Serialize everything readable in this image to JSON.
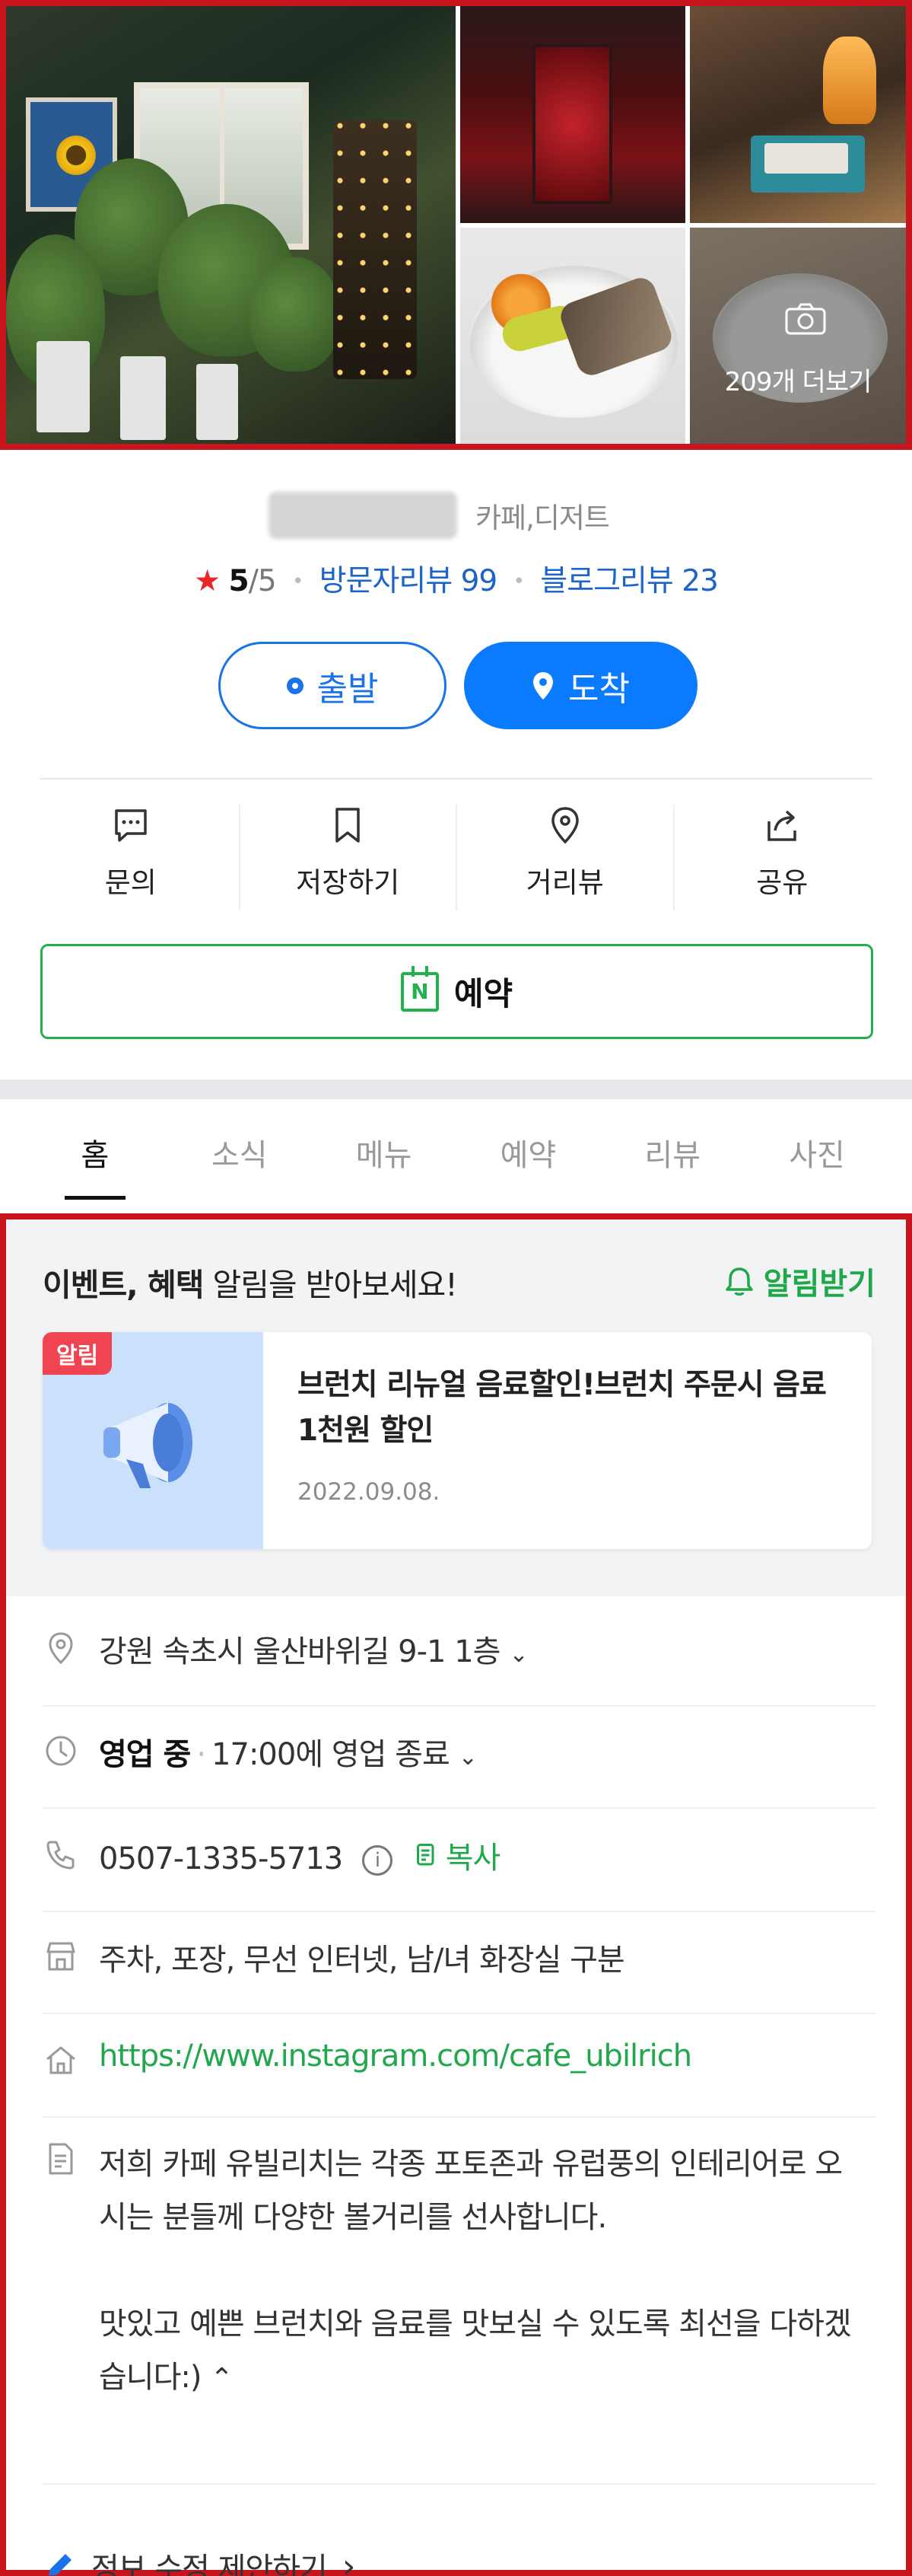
{
  "gallery": {
    "more_label": "209개 더보기",
    "photos": [
      "interior-plants",
      "red-door",
      "vintage-turntable",
      "brunch-plate",
      "brunch-table"
    ]
  },
  "place": {
    "name": "",
    "category": "카페,디저트",
    "rating_star": "★",
    "rating_score": "5",
    "rating_outof": "/5",
    "visitor_reviews": "방문자리뷰 99",
    "blog_reviews": "블로그리뷰 23"
  },
  "route": {
    "start_label": "출발",
    "arrive_label": "도착"
  },
  "actions": {
    "inquiry": "문의",
    "save": "저장하기",
    "street_view": "거리뷰",
    "share": "공유"
  },
  "reserve": {
    "label": "예약",
    "icon_letter": "N"
  },
  "tabs": [
    "홈",
    "소식",
    "메뉴",
    "예약",
    "리뷰",
    "사진"
  ],
  "notice": {
    "title_bold": "이벤트, 혜택",
    "title_rest": " 알림을 받아보세요!",
    "notify_label": "알림받기",
    "badge": "알림",
    "text": "브런치 리뉴얼 음료할인!브런치 주문시 음료 1천원 할인",
    "date": "2022.09.08."
  },
  "info": {
    "address": "강원 속초시 울산바위길 9-1 1층",
    "hours_status": "영업 중",
    "hours_detail": "17:00에 영업 종료",
    "phone": "0507-1335-5713",
    "info_glyph": "i",
    "copy_label": "복사",
    "amenities": "주차, 포장, 무선 인터넷, 남/녀 화장실 구분",
    "website": "https://www.instagram.com/cafe_ubilrich",
    "description": "저희 카페 유빌리치는 각종 포토존과 유럽풍의 인테리어로 오시는 분들께 다양한 볼거리를 선사합니다.\n\n맛있고 예쁜 브런치와 음료를 맛보실 수 있도록 최선을 다하겠습니다:)",
    "edit_label": "정보 수정 제안하기",
    "chevron_down": "⌄",
    "chevron_up": "⌃",
    "chevron_right": "›"
  },
  "colors": {
    "accent_blue": "#0a7bff",
    "green": "#22b14c",
    "star_red": "#e8272c",
    "frame_red": "#c8141c"
  }
}
